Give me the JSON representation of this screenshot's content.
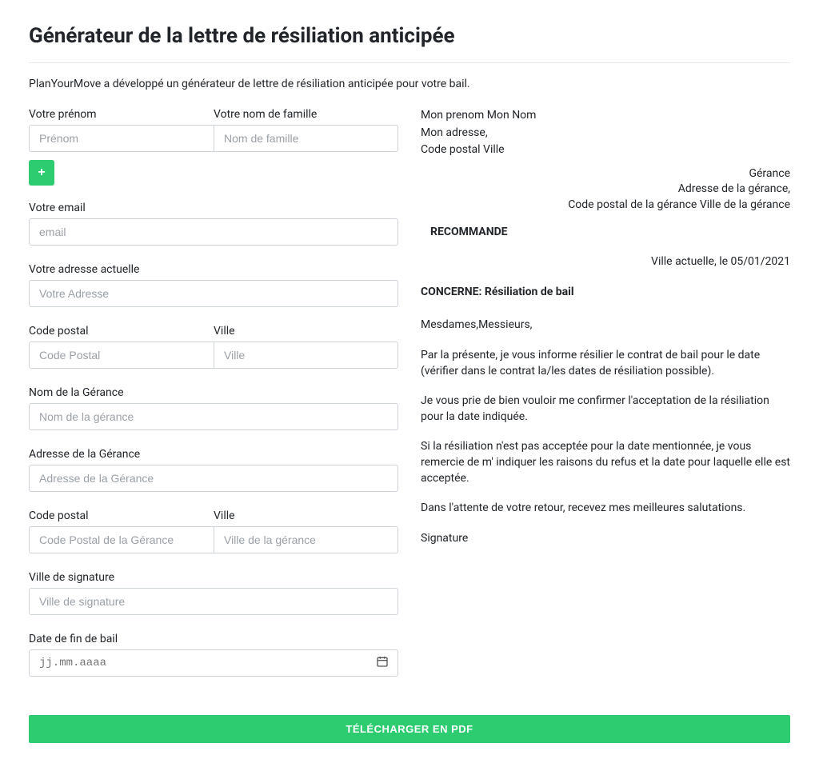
{
  "page": {
    "title": "Générateur de la lettre de résiliation anticipée",
    "intro": "PlanYourMove a développé un générateur de lettre de résiliation anticipée pour votre bail."
  },
  "form": {
    "firstname_label": "Votre prénom",
    "firstname_placeholder": "Prénom",
    "lastname_label": "Votre nom de famille",
    "lastname_placeholder": "Nom de famille",
    "add_label": "+",
    "email_label": "Votre email",
    "email_placeholder": "email",
    "address_label": "Votre adresse actuelle",
    "address_placeholder": "Votre Adresse",
    "postal_label": "Code postal",
    "postal_placeholder": "Code Postal",
    "city_label": "Ville",
    "city_placeholder": "Ville",
    "gerance_name_label": "Nom de la Gérance",
    "gerance_name_placeholder": "Nom de la gérance",
    "gerance_address_label": "Adresse de la Gérance",
    "gerance_address_placeholder": "Adresse de la Gérance",
    "gerance_postal_label": "Code postal",
    "gerance_postal_placeholder": "Code Postal de la Gérance",
    "gerance_city_label": "Ville",
    "gerance_city_placeholder": "Ville de la gérance",
    "sign_city_label": "Ville de signature",
    "sign_city_placeholder": "Ville de signature",
    "end_date_label": "Date de fin de bail",
    "end_date_placeholder": "jj.mm.aaaa",
    "download_label": "TÉLÉCHARGER EN PDF"
  },
  "letter": {
    "sender_name": "Mon prenom Mon Nom",
    "sender_address": "Mon adresse,",
    "sender_postal_city": "Code postal Ville",
    "gerance_name": "Gérance",
    "gerance_address": "Adresse de la gérance,",
    "gerance_postal_city": "Code postal de la gérance Ville de la gérance",
    "recommande": "RECOMMANDE",
    "date_line": "Ville actuelle, le 05/01/2021",
    "concerne": "CONCERNE: Résiliation de bail",
    "salutation": "Mesdames,Messieurs,",
    "p1": "Par la présente, je vous informe résilier le contrat de bail pour le date (vérifier dans le contrat la/les dates de résiliation possible).",
    "p2": "Je vous prie de bien vouloir me confirmer l'acceptation de la résiliation pour la date indiquée.",
    "p3": "Si la résiliation n'est pas acceptée pour la date mentionnée, je vous remercie de m' indiquer les raisons du refus et la date pour laquelle elle est acceptée.",
    "p4": "Dans l'attente de votre retour, recevez mes meilleures salutations.",
    "signature": "Signature"
  }
}
